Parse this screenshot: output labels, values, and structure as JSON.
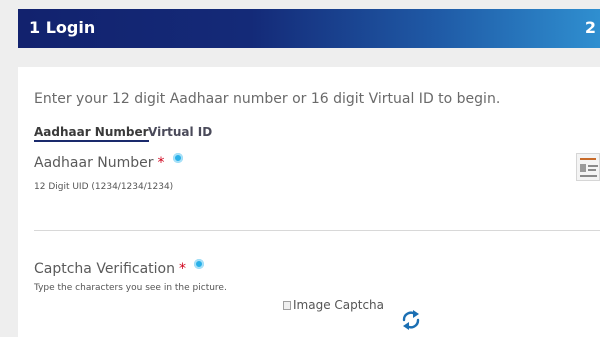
{
  "header": {
    "title": "1 Login",
    "next_step": "2"
  },
  "intro_text": "Enter your 12 digit Aadhaar number or 16 digit Virtual ID to begin.",
  "tabs": [
    {
      "label": "Aadhaar Number",
      "active": true
    },
    {
      "label": "Virtual ID",
      "active": false
    }
  ],
  "aadhaar_field": {
    "label": "Aadhaar Number",
    "required_mark": "*",
    "hint": "12 Digit UID (1234/1234/1234)"
  },
  "captcha_field": {
    "label": "Captcha Verification",
    "required_mark": "*",
    "hint": "Type the characters you see in the picture.",
    "image_alt": "Image Captcha"
  },
  "icons": {
    "info": "info-icon",
    "refresh": "refresh-icon",
    "aadhaar_card_thumbnail": "aadhaar-card-icon"
  },
  "colors": {
    "header_start": "#12226e",
    "header_end": "#2f8fd0",
    "required": "#d0021b",
    "info": "#29b0e8",
    "refresh": "#1b6fb3"
  }
}
